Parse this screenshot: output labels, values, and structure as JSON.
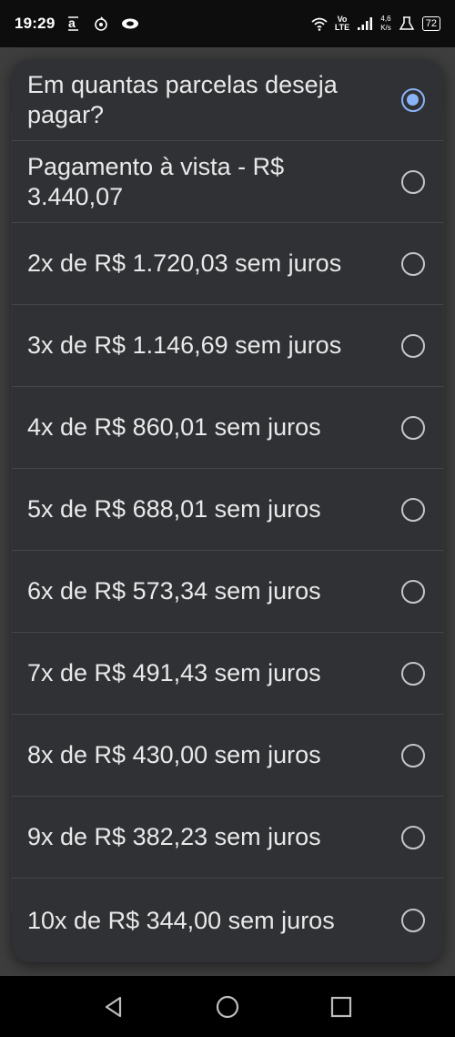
{
  "status_bar": {
    "time": "19:29",
    "volte_top": "Vo",
    "volte_bottom": "LTE",
    "speed_value": "4,6",
    "speed_unit": "K/s",
    "battery": "72"
  },
  "dialog": {
    "title": "Em quantas parcelas deseja pagar?",
    "options": [
      {
        "label": "Pagamento à vista - R$ 3.440,07",
        "selected": false
      },
      {
        "label": "2x de R$ 1.720,03 sem juros",
        "selected": false
      },
      {
        "label": "3x de R$ 1.146,69 sem juros",
        "selected": false
      },
      {
        "label": "4x de R$ 860,01 sem juros",
        "selected": false
      },
      {
        "label": "5x de R$ 688,01 sem juros",
        "selected": false
      },
      {
        "label": "6x de R$ 573,34 sem juros",
        "selected": false
      },
      {
        "label": "7x de R$ 491,43 sem juros",
        "selected": false
      },
      {
        "label": "8x de R$ 430,00 sem juros",
        "selected": false
      },
      {
        "label": "9x de R$ 382,23 sem juros",
        "selected": false
      },
      {
        "label": "10x de R$ 344,00 sem juros",
        "selected": false
      }
    ]
  },
  "colors": {
    "dialog_bg": "#303134",
    "radio_selected": "#8ab4f8",
    "radio_unselected": "#c4c6ca",
    "text": "#e9e9ea"
  },
  "nav_bar": {
    "icons": [
      "back-triangle-icon",
      "home-circle-icon",
      "recents-square-icon"
    ]
  }
}
